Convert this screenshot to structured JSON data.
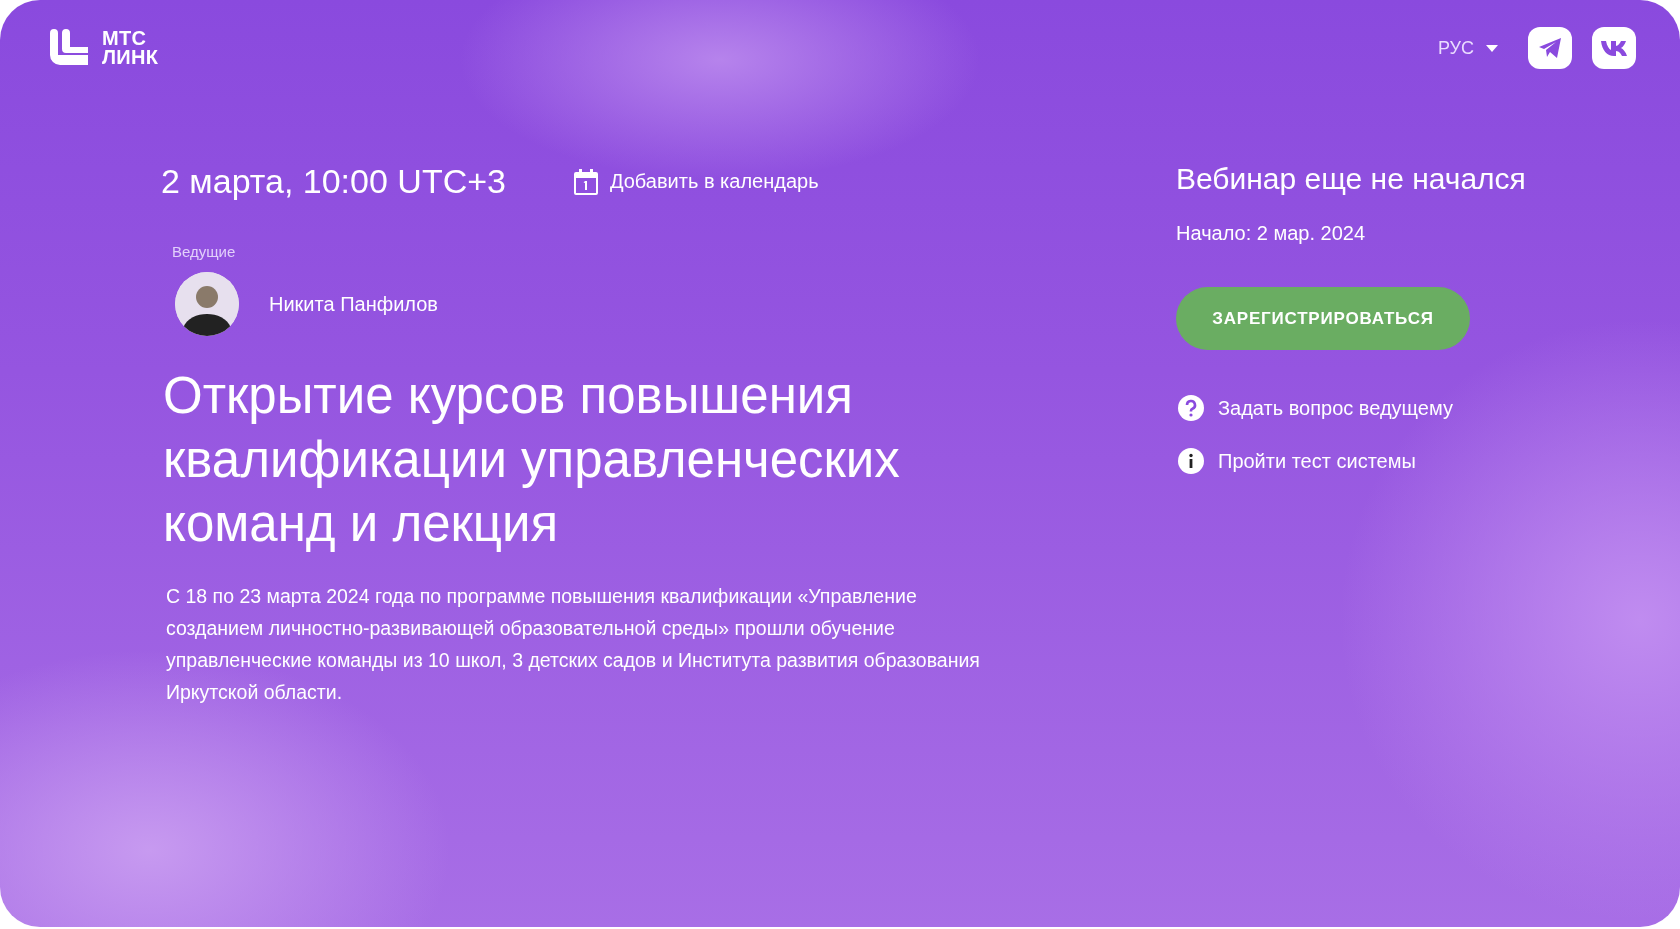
{
  "header": {
    "logo_text": [
      "МТС",
      "ЛИНК"
    ],
    "language": "РУС"
  },
  "event": {
    "datetime": "2 марта, 10:00 UTC+3",
    "add_to_calendar": "Добавить в календарь",
    "hosts_label": "Ведущие",
    "hosts": [
      {
        "name": "Никита Панфилов"
      }
    ],
    "title": "Открытие курсов повышения квалификации управленческих команд и лекция",
    "description": "С 18 по 23 марта 2024 года по программе повышения квалификации «Управление созданием личностно-развивающей образовательной среды» прошли обучение управленческие команды из 10 школ, 3 детских садов и Института развития образования Иркутской области."
  },
  "status": {
    "title": "Вебинар еще не начался",
    "start": "Начало: 2 мар. 2024",
    "register_button": "ЗАРЕГИСТРИРОВАТЬСЯ",
    "links": [
      {
        "kind": "question",
        "label": "Задать вопрос ведущему"
      },
      {
        "kind": "info",
        "label": "Пройти тест системы"
      }
    ]
  }
}
